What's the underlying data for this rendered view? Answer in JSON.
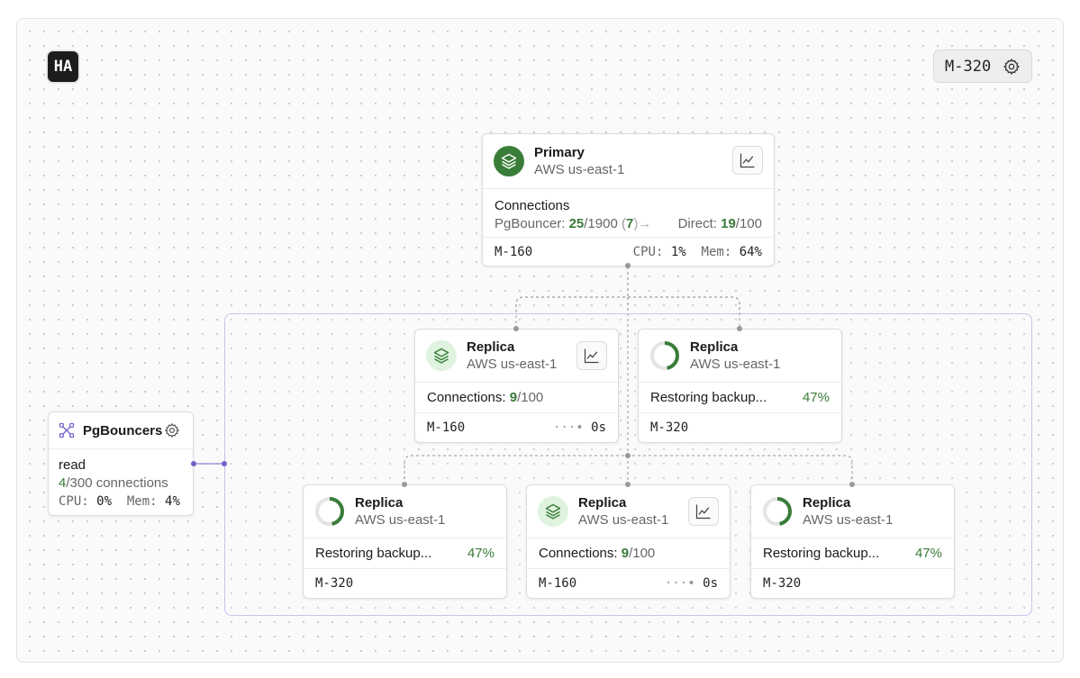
{
  "app": {
    "logo": "HA",
    "instance_size": "M-320"
  },
  "primary": {
    "title": "Primary",
    "region": "AWS us-east-1",
    "connections_label": "Connections",
    "pgbouncer_label": "PgBouncer:",
    "pgbouncer_used": "25",
    "pgbouncer_total": "/1900",
    "pgbouncer_extra": "7",
    "direct_label": "Direct:",
    "direct_used": "19",
    "direct_total": "/100",
    "size": "M-160",
    "cpu_label": "CPU:",
    "cpu": "1%",
    "mem_label": "Mem:",
    "mem": "64%"
  },
  "replicas": [
    {
      "title": "Replica",
      "region": "AWS us-east-1",
      "status": "active",
      "conn_label": "Connections:",
      "conn_used": "9",
      "conn_total": "/100",
      "size": "M-160",
      "lag": "0s"
    },
    {
      "title": "Replica",
      "region": "AWS us-east-1",
      "status": "restoring",
      "restore_label": "Restoring backup...",
      "progress": "47%",
      "size": "M-320"
    },
    {
      "title": "Replica",
      "region": "AWS us-east-1",
      "status": "restoring",
      "restore_label": "Restoring backup...",
      "progress": "47%",
      "size": "M-320"
    },
    {
      "title": "Replica",
      "region": "AWS us-east-1",
      "status": "active",
      "conn_label": "Connections:",
      "conn_used": "9",
      "conn_total": "/100",
      "size": "M-160",
      "lag": "0s"
    },
    {
      "title": "Replica",
      "region": "AWS us-east-1",
      "status": "restoring",
      "restore_label": "Restoring backup...",
      "progress": "47%",
      "size": "M-320"
    }
  ],
  "pgbouncers": {
    "title": "PgBouncers",
    "mode": "read",
    "conn_used": "4",
    "conn_total": "/300 connections",
    "cpu_label": "CPU:",
    "cpu": "0%",
    "mem_label": "Mem:",
    "mem": "4%"
  },
  "colors": {
    "accent_green": "#3a7a3a",
    "group_border": "#c9c4ee",
    "pgbouncer_purple": "#6f63c9"
  }
}
